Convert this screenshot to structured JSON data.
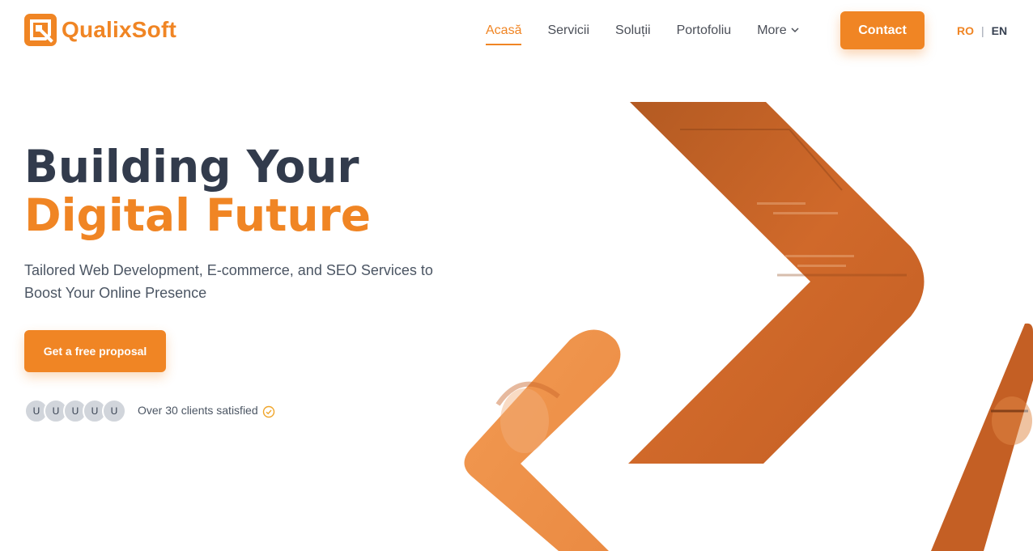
{
  "brand": {
    "name": "QualixSoft",
    "color": "#f08524"
  },
  "nav": {
    "items": [
      {
        "label": "Acasă",
        "active": true
      },
      {
        "label": "Servicii",
        "active": false
      },
      {
        "label": "Soluții",
        "active": false
      },
      {
        "label": "Portofoliu",
        "active": false
      },
      {
        "label": "More",
        "active": false,
        "icon": "chevron-down-icon"
      }
    ],
    "contact_label": "Contact",
    "languages": {
      "ro": "RO",
      "separator": "|",
      "en": "EN",
      "active": "RO"
    }
  },
  "hero": {
    "title_line1": "Building Your",
    "title_line2": "Digital Future",
    "subtitle": "Tailored Web Development, E-commerce, and SEO Services to Boost Your Online Presence",
    "cta_label": "Get a free proposal",
    "avatars": [
      "U",
      "U",
      "U",
      "U",
      "U"
    ],
    "clients_text": "Over 30 clients satisfied",
    "clients_icon": "check-circle-icon"
  },
  "colors": {
    "accent": "#f08524",
    "title_dark": "#323b4c"
  }
}
